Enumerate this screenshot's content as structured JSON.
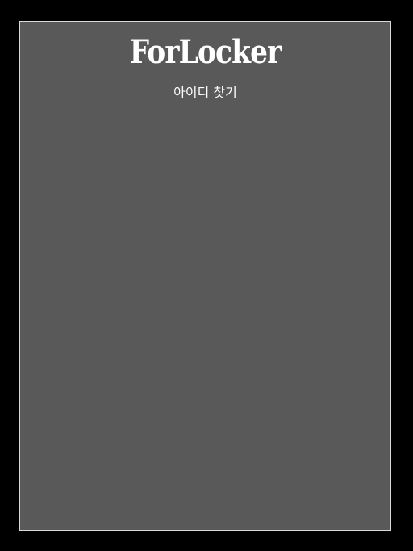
{
  "header": {
    "logo_text": "ForLocker",
    "subtitle": "아이디 찾기"
  },
  "colors": {
    "page_background": "#000000",
    "panel_background": "#595959",
    "panel_border": "#d9d9d9",
    "text": "#ffffff"
  }
}
